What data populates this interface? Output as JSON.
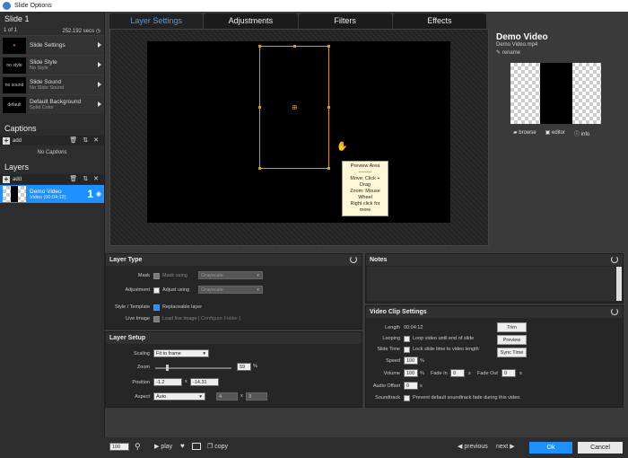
{
  "window": {
    "title": "Slide Options"
  },
  "sidebar": {
    "slide_title": "Slide 1",
    "slide_counter": "1 of 1",
    "slide_duration": "252.192 secs",
    "settings": [
      {
        "title": "Slide Settings",
        "subtitle": "",
        "thumb": ""
      },
      {
        "title": "Slide Style",
        "subtitle": "No Style",
        "thumb": "no style"
      },
      {
        "title": "Slide Sound",
        "subtitle": "No Slide Sound",
        "thumb": "no sound"
      },
      {
        "title": "Default Background",
        "subtitle": "Solid Color",
        "thumb": "default"
      }
    ],
    "captions_title": "Captions",
    "captions_add": "add",
    "no_captions": "No Captions",
    "layers_title": "Layers",
    "layers_add": "add",
    "layer": {
      "name": "Demo Video",
      "duration": "Video (00:04:12)",
      "number": "1"
    }
  },
  "tabs": [
    "Layer Settings",
    "Adjustments",
    "Filters",
    "Effects"
  ],
  "preview_tip": {
    "title": "Preview Area",
    "sep": "--------",
    "l1": "Move: Click + Drag",
    "l2": "Zoom: Mouse Wheel",
    "l3": "Right click for more"
  },
  "info": {
    "title": "Demo Video",
    "file": "Demo Video.mp4",
    "rename": "rename",
    "browse": "browse",
    "editor": "editor",
    "info": "info"
  },
  "layer_type": {
    "title": "Layer Type",
    "mask_label": "Mask",
    "mask_using": "Mask using",
    "mask_select": "Grayscale",
    "adj_label": "Adjustment",
    "adj_using": "Adjust using",
    "adj_select": "Grayscale",
    "style_label": "Style / Template",
    "replaceable": "Replaceable layer",
    "live_label": "Live Image",
    "load_live": "Load live image",
    "configure": "[ Configure Folder ]"
  },
  "layer_setup": {
    "title": "Layer Setup",
    "scaling_label": "Scaling",
    "scaling": "Fit to frame",
    "zoom_label": "Zoom",
    "zoom": "59",
    "pct": "%",
    "position_label": "Position",
    "pos_x": "-1.2",
    "pos_y": "-14.31",
    "aspect_label": "Aspect",
    "aspect": "Auto",
    "asp_w": "4",
    "asp_h": "3"
  },
  "notes": {
    "title": "Notes"
  },
  "video": {
    "title": "Video Clip Settings",
    "length_label": "Length",
    "length": "00:04:12",
    "looping_label": "Looping",
    "looping": "Loop video until end of slide",
    "slide_time_label": "Slide Time",
    "slide_time": "Lock slide time to video length",
    "speed_label": "Speed",
    "speed": "100",
    "volume_label": "Volume",
    "volume": "100",
    "fade_in_label": "Fade In",
    "fade_in": "0",
    "fade_out_label": "Fade Out",
    "fade_out": "0",
    "s": "s",
    "pct": "%",
    "offset_label": "Audio Offset",
    "offset": "0",
    "soundtrack_label": "Soundtrack",
    "soundtrack": "Prevent default soundtrack fade during this video.",
    "trim": "Trim",
    "preview": "Preview",
    "sync": "Sync Time"
  },
  "bottom": {
    "zoom": "100",
    "play": "play",
    "copy": "copy",
    "previous": "previous",
    "next": "next",
    "ok": "Ok",
    "cancel": "Cancel"
  },
  "colors": {
    "accent": "#1e90ff",
    "selection": "#d59a1a"
  }
}
